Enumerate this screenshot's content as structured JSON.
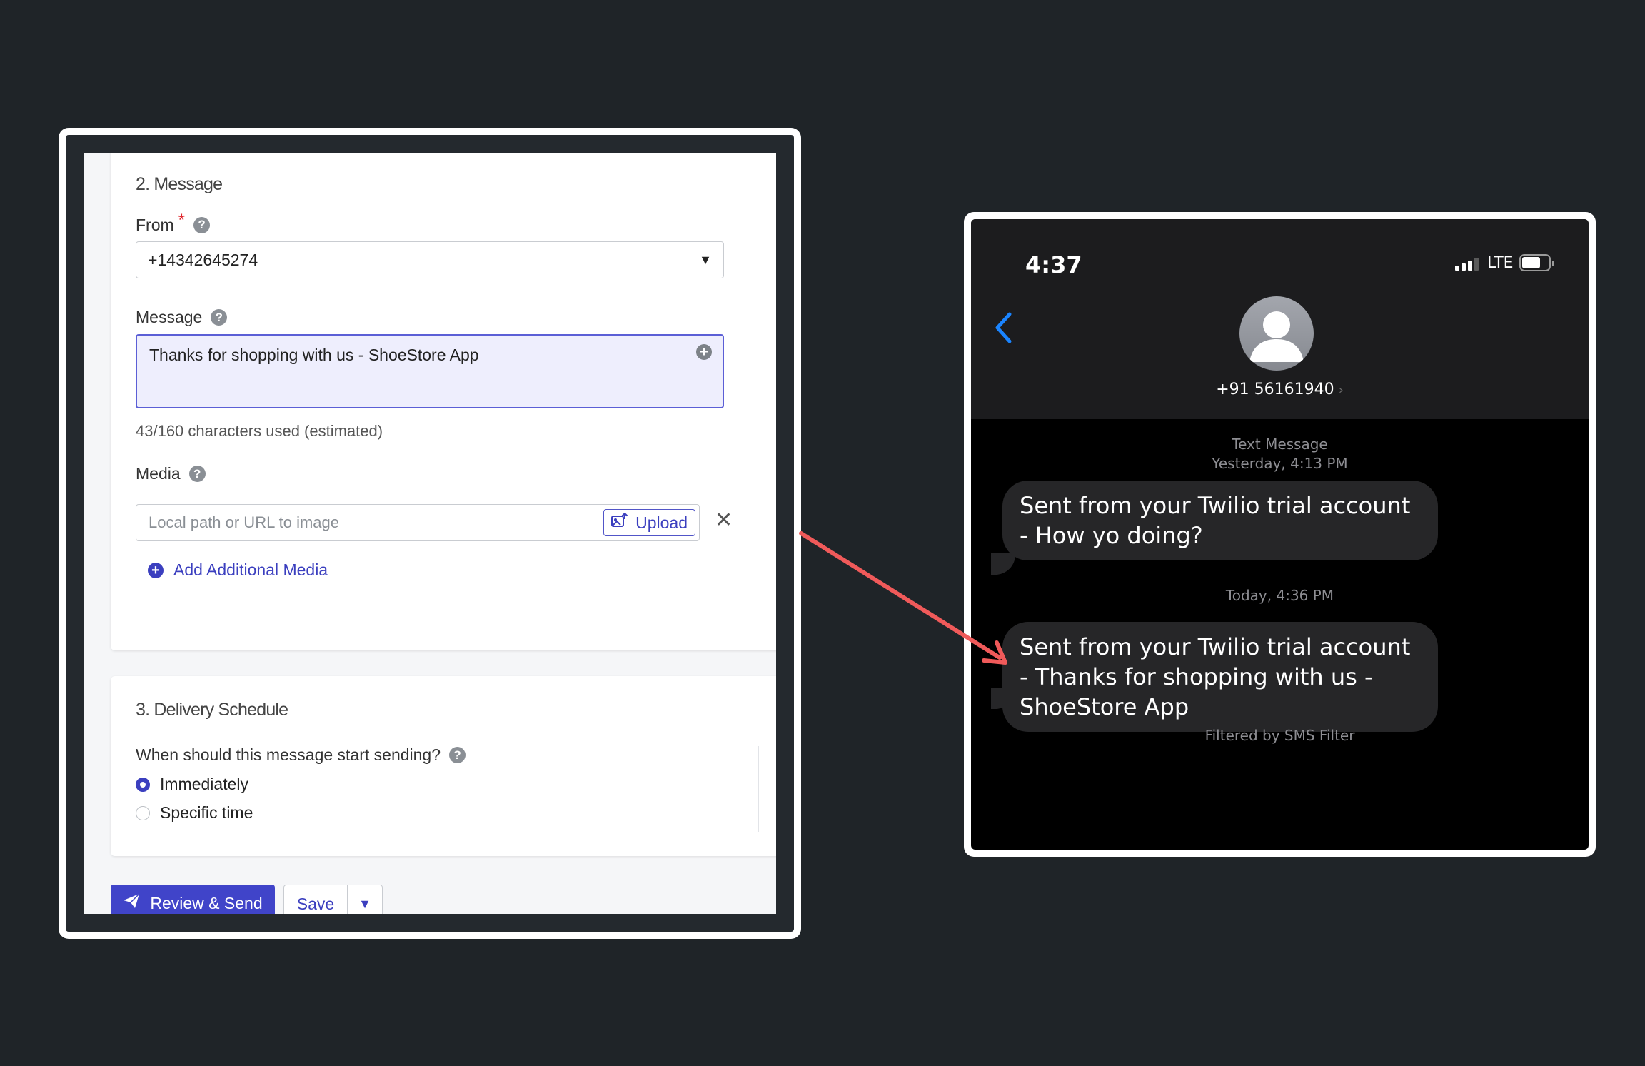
{
  "form": {
    "message_section": {
      "title": "2. Message",
      "from_label": "From",
      "required_mark": "*",
      "from_value": "+14342645274",
      "message_label": "Message",
      "message_value": "Thanks for shopping with us - ShoeStore App",
      "char_count_hint": "43/160 characters used (estimated)",
      "media_label": "Media",
      "media_placeholder": "Local path or URL to image",
      "upload_label": "Upload",
      "add_media_label": "Add Additional Media"
    },
    "schedule_section": {
      "title": "3. Delivery Schedule",
      "question": "When should this message start sending?",
      "options": [
        {
          "label": "Immediately",
          "selected": true
        },
        {
          "label": "Specific time",
          "selected": false
        }
      ]
    },
    "actions": {
      "review_send_label": "Review & Send",
      "save_label": "Save"
    },
    "icons": [
      "help-icon",
      "dropdown-arrow-icon",
      "add-variable-icon",
      "upload-image-icon",
      "close-icon",
      "add-circle-icon",
      "info-icon",
      "send-plane-icon"
    ]
  },
  "phone": {
    "status": {
      "time": "4:37",
      "network": "LTE",
      "battery_level": 0.7
    },
    "contact": "+91 56161940",
    "messages": [
      {
        "meta_line1": "Text Message",
        "meta_line2": "Yesterday, 4:13 PM",
        "text": "Sent from your Twilio trial account - How yo doing?"
      },
      {
        "meta_line1": "Today, 4:36 PM",
        "text": "Sent from your Twilio trial account - Thanks for shopping with us - ShoeStore App"
      }
    ],
    "footer": "Filtered by SMS Filter"
  },
  "colors": {
    "background": "#1f2428",
    "accent": "#4044c9",
    "arrow": "#f05a5a",
    "bubble": "#262628"
  }
}
